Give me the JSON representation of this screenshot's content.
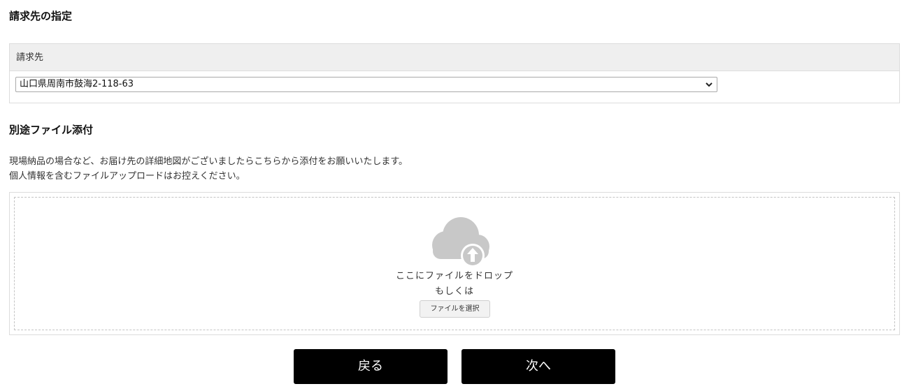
{
  "billing": {
    "section_title": "請求先の指定",
    "column_header": "請求先",
    "selected_address": "山口県周南市鼓海2-118-63"
  },
  "attachment": {
    "section_title": "別途ファイル添付",
    "description_line1": "現場納品の場合など、お届け先の詳細地図がございましたらこちらから添付をお願いいたします。",
    "description_line2": "個人情報を含むファイルアップロードはお控えください。",
    "drop_text": "ここにファイルをドロップ",
    "or_text": "もしくは",
    "select_file_label": "ファイルを選択",
    "upload_icon": "cloud-upload-icon"
  },
  "navigation": {
    "back_label": "戻る",
    "next_label": "次へ"
  },
  "colors": {
    "primary_button_bg": "#000000",
    "table_header_bg": "#efefef",
    "upload_icon_color": "#c8c8c8"
  }
}
